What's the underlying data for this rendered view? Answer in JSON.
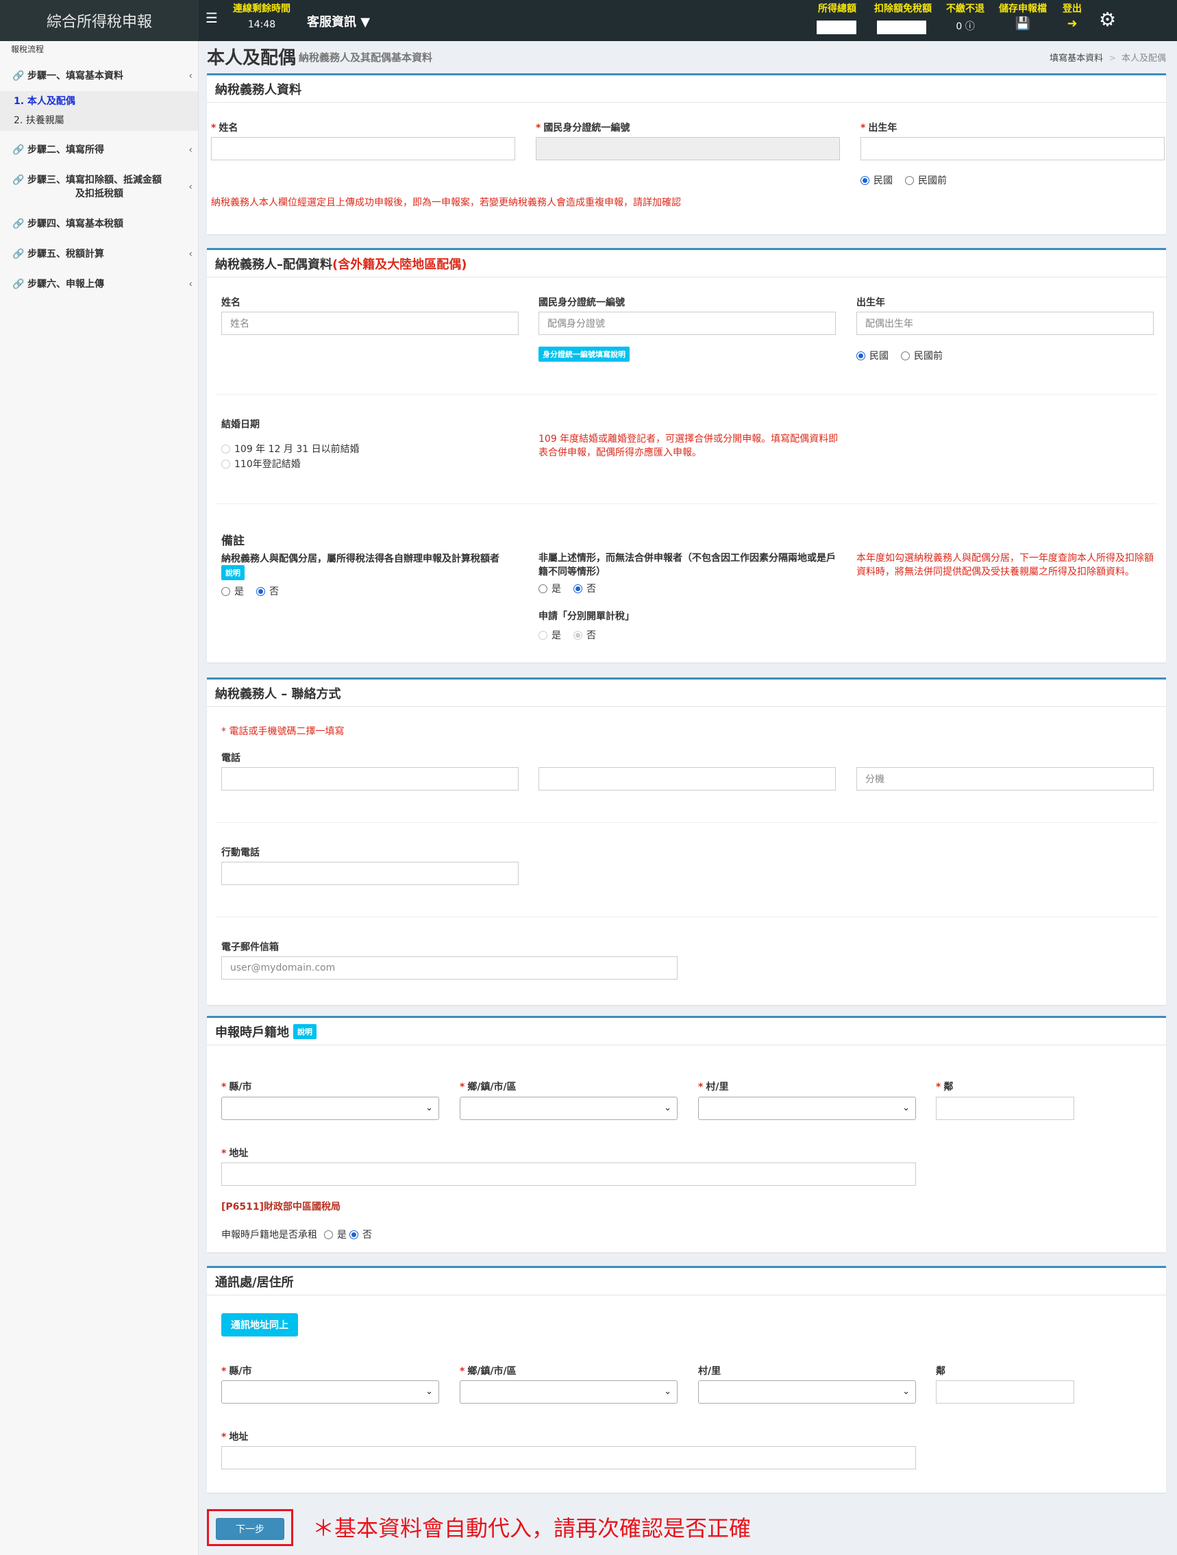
{
  "topbar": {
    "brand": "綜合所得稅申報",
    "menu_icon": "hamburger-icon",
    "timer_label": "連線剩餘時間",
    "timer_value": "14:48",
    "service_label": "客服資訊",
    "income_total_label": "所得總額",
    "deduction_label": "扣除額免稅額",
    "no_refund_label": "不繳不退",
    "no_refund_value": "0",
    "save_label": "儲存申報檔",
    "logout_label": "登出",
    "settings_icon": "gear-icon"
  },
  "sidebar": {
    "heading": "報稅流程",
    "steps": [
      {
        "label": "步驟一、填寫基本資料"
      },
      {
        "label": "步驟二、填寫所得"
      },
      {
        "label": "步驟三、填寫扣除額、抵減金額",
        "label2": "及扣抵稅額"
      },
      {
        "label": "步驟四、填寫基本稅額"
      },
      {
        "label": "步驟五、稅額計算"
      },
      {
        "label": "步驟六、申報上傳"
      }
    ],
    "sub_items": [
      "1. 本人及配偶",
      "2. 扶養親屬"
    ]
  },
  "header": {
    "title": "本人及配偶",
    "subtitle": "納稅義務人及其配偶基本資料",
    "breadcrumb": [
      "填寫基本資料",
      "本人及配偶"
    ],
    "breadcrumb_sep": ">"
  },
  "taxpayer": {
    "title": "納稅義務人資料",
    "name_label": "姓名",
    "id_label": "國民身分證統一編號",
    "birth_label": "出生年",
    "era_options": [
      "民國",
      "民國前"
    ],
    "warning": "納稅義務人本人欄位經選定且上傳成功申報後，即為一申報案，若變更納稅義務人會造成重複申報，請詳加確認"
  },
  "spouse": {
    "title": "納稅義務人–配偶資料",
    "title_red": "(含外籍及大陸地區配偶)",
    "name_label": "姓名",
    "name_placeholder": "姓名",
    "id_label": "國民身分證統一編號",
    "id_placeholder": "配偶身分證號",
    "id_help": "身分證統一編號填寫說明",
    "birth_label": "出生年",
    "birth_placeholder": "配偶出生年",
    "era_options": [
      "民國",
      "民國前"
    ],
    "marriage_label": "結婚日期",
    "marriage_options": [
      "109 年 12 月 31 日以前結婚",
      "110年登記結婚"
    ],
    "marriage_note": "109 年度結婚或離婚登記者，可選擇合併或分開申報。填寫配偶資料即表合併申報，配偶所得亦應匯入申報。",
    "remarks_label": "備註",
    "separate_label": "納稅義務人與配偶分居，屬所得稅法得各自辦理申報及計算稅額者",
    "explain": "說明",
    "other_label": "非屬上述情形，而無法合併申報者（不包含因工作因素分隔兩地或是戶籍不同等情形）",
    "separate_calc_label": "申請「分別開單計稅」",
    "yes": "是",
    "no": "否",
    "separate_note": "本年度如勾選納稅義務人與配偶分居，下一年度查詢本人所得及扣除額資料時，將無法併同提供配偶及受扶養親屬之所得及扣除額資料。"
  },
  "contact": {
    "title": "納稅義務人 – 聯絡方式",
    "hint": "* 電話或手機號碼二擇一填寫",
    "phone_label": "電話",
    "ext_placeholder": "分機",
    "mobile_label": "行動電話",
    "email_label": "電子郵件信箱",
    "email_placeholder": "user@mydomain.com"
  },
  "household": {
    "title": "申報時戶籍地",
    "explain": "說明",
    "county_label": "縣/市",
    "town_label": "鄉/鎮/市/區",
    "village_label": "村/里",
    "neighbor_label": "鄰",
    "address_label": "地址",
    "office": "[P6511]財政部中區國稅局",
    "rent_label": "申報時戶籍地是否承租",
    "yes": "是",
    "no": "否"
  },
  "mailing": {
    "title": "通訊處/居住所",
    "same_button": "通訊地址同上",
    "county_label": "縣/市",
    "town_label": "鄉/鎮/市/區",
    "village_label": "村/里",
    "neighbor_label": "鄰",
    "address_label": "地址"
  },
  "footer": {
    "next_button": "下一步",
    "note": "＊基本資料會自動代入，請再次確認是否正確"
  },
  "colors": {
    "accent": "#3c8dbc",
    "warning": "#dd2a1b",
    "topbar_label": "#f5e50a",
    "info": "#00c0ef"
  }
}
